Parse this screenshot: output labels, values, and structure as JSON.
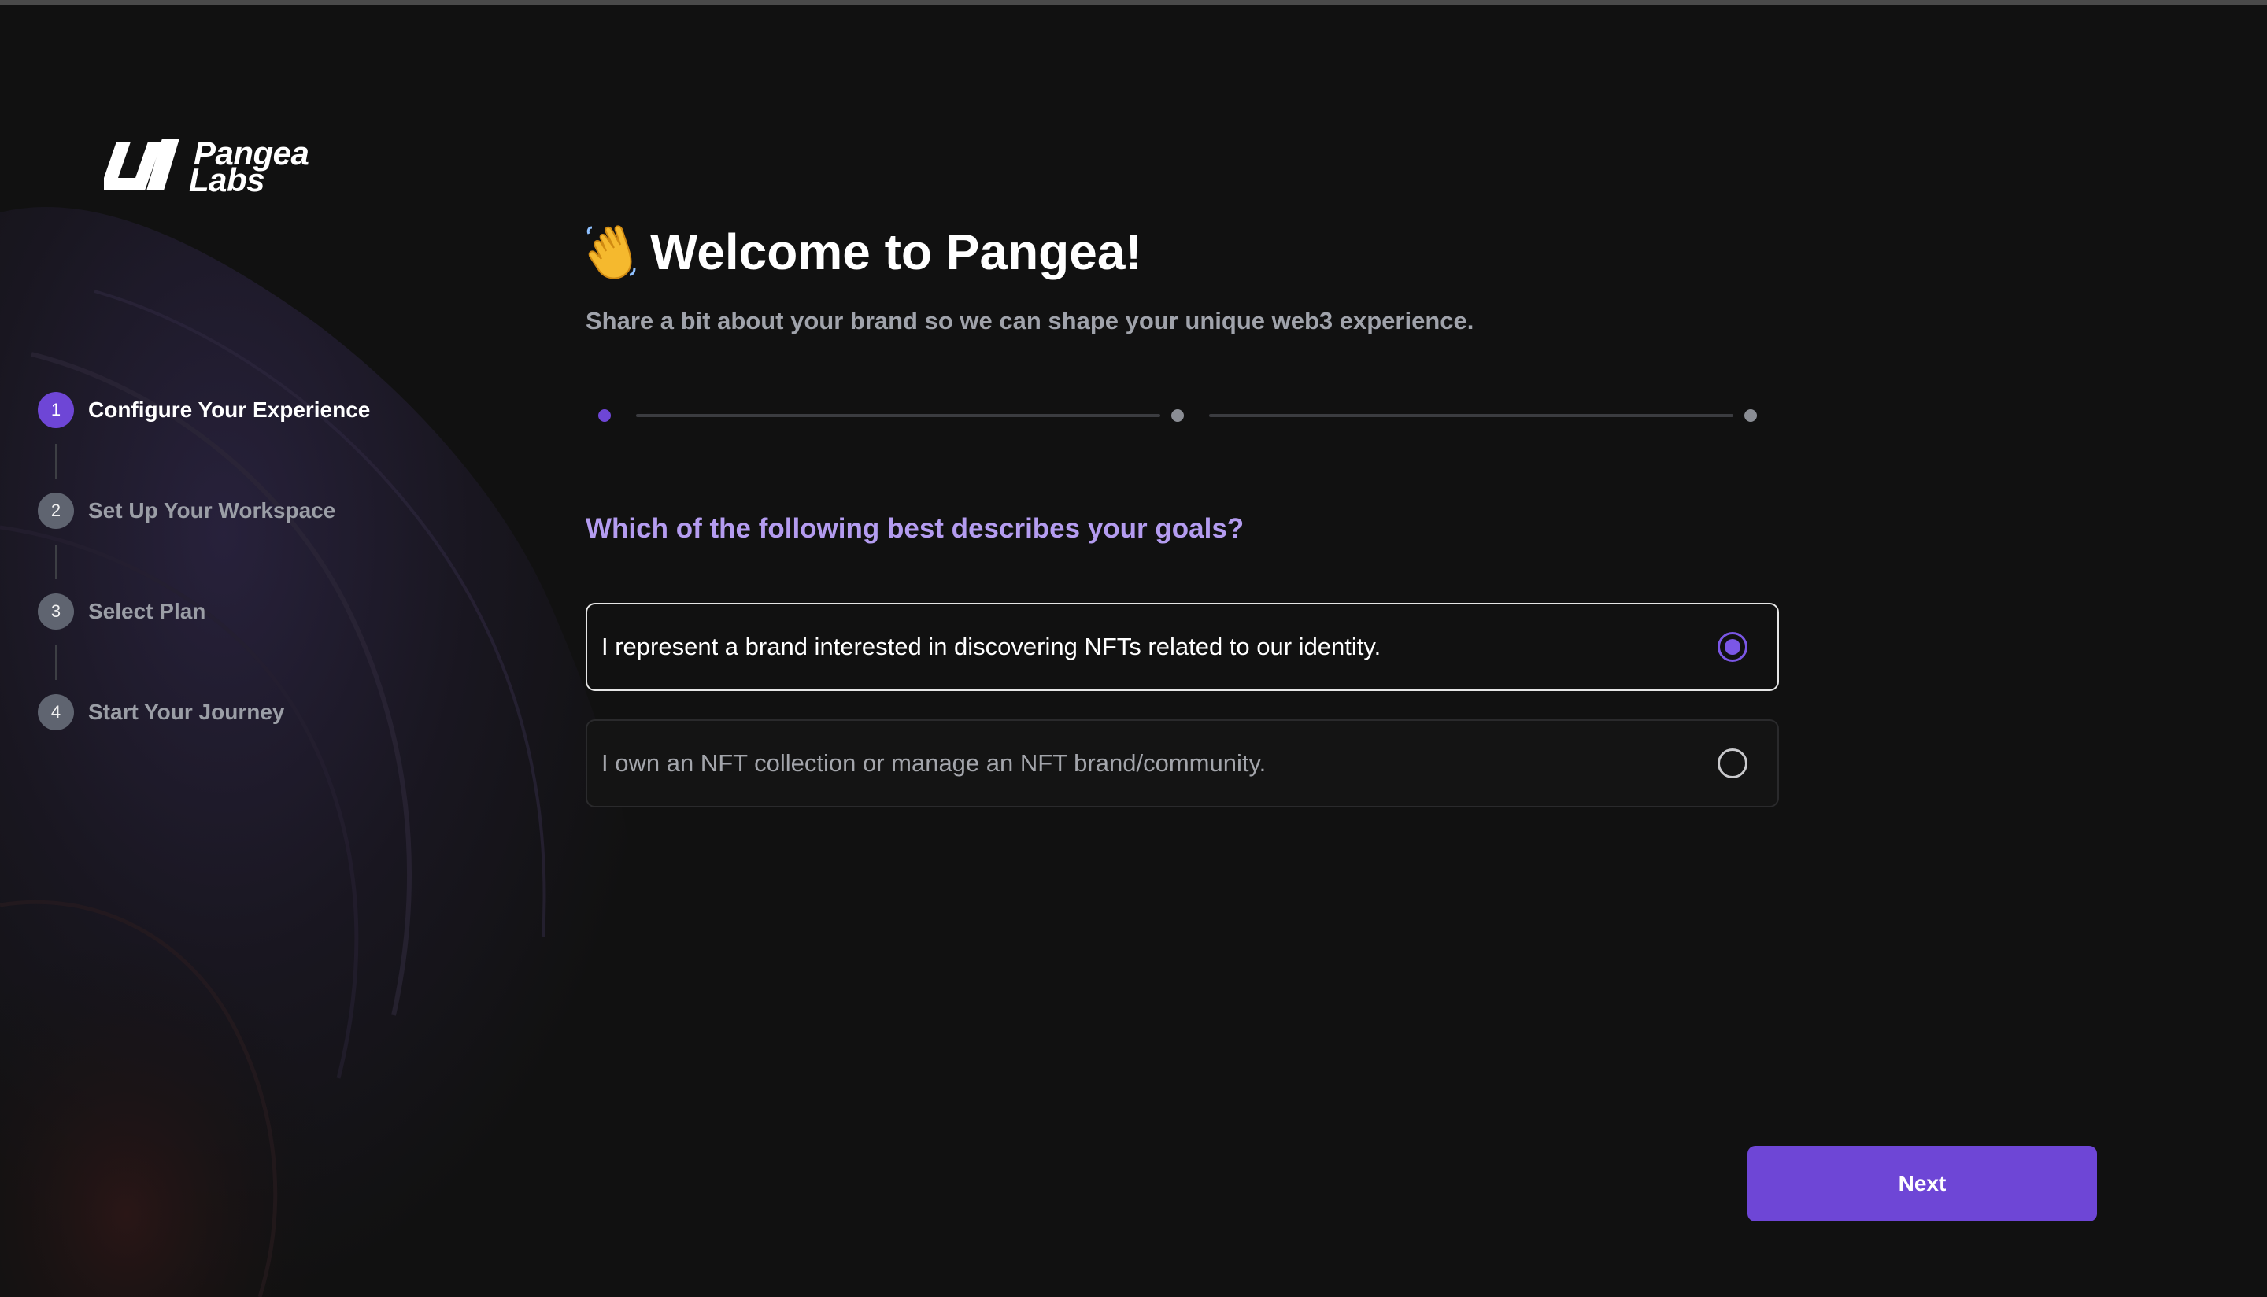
{
  "brand": {
    "name_line1": "Pangea",
    "name_line2": "Labs",
    "logo_icon": "pangea-slash-logo"
  },
  "colors": {
    "background": "#111111",
    "accent": "#6e46d6",
    "question": "#b49cf0",
    "step_inactive": "#5f6470"
  },
  "steps": [
    {
      "number": "1",
      "label": "Configure Your Experience",
      "active": true
    },
    {
      "number": "2",
      "label": "Set Up Your Workspace",
      "active": false
    },
    {
      "number": "3",
      "label": "Select Plan",
      "active": false
    },
    {
      "number": "4",
      "label": "Start Your Journey",
      "active": false
    }
  ],
  "header": {
    "emoji": "waving-hand",
    "title": "Welcome to Pangea!",
    "subtitle": "Share a bit about your brand so we can shape your unique web3 experience."
  },
  "progress": {
    "current_stage": 1,
    "total_stages": 3
  },
  "question": "Which of the following best describes your goals?",
  "options": [
    {
      "label": "I represent a brand interested in discovering NFTs related to our identity.",
      "selected": true
    },
    {
      "label": "I own an NFT collection or manage an NFT brand/community.",
      "selected": false
    }
  ],
  "actions": {
    "next_label": "Next"
  }
}
